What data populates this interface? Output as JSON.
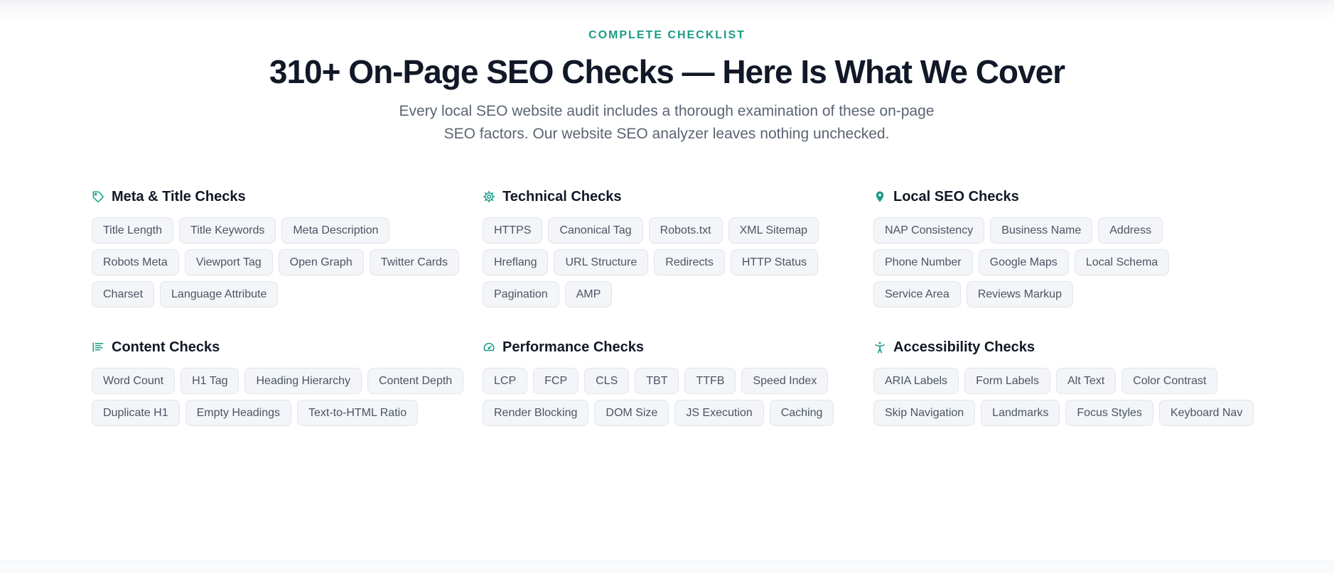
{
  "section": {
    "eyebrow": "COMPLETE CHECKLIST",
    "title": "310+ On-Page SEO Checks — Here Is What We Cover",
    "subtitle": "Every local SEO website audit includes a thorough examination of these on-page SEO factors. Our website SEO analyzer leaves nothing unchecked."
  },
  "colors": {
    "accent": "#1a9c86",
    "heading": "#111827",
    "tag_bg": "#f3f5f8",
    "tag_border": "#e1e5ea"
  },
  "groups": [
    {
      "icon": "tag-icon",
      "title": "Meta & Title Checks",
      "tags": [
        "Title Length",
        "Title Keywords",
        "Meta Description",
        "Robots Meta",
        "Viewport Tag",
        "Open Graph",
        "Twitter Cards",
        "Charset",
        "Language Attribute"
      ]
    },
    {
      "icon": "gear-icon",
      "title": "Technical Checks",
      "tags": [
        "HTTPS",
        "Canonical Tag",
        "Robots.txt",
        "XML Sitemap",
        "Hreflang",
        "URL Structure",
        "Redirects",
        "HTTP Status",
        "Pagination",
        "AMP"
      ]
    },
    {
      "icon": "map-pin-icon",
      "title": "Local SEO Checks",
      "tags": [
        "NAP Consistency",
        "Business Name",
        "Address",
        "Phone Number",
        "Google Maps",
        "Local Schema",
        "Service Area",
        "Reviews Markup"
      ]
    },
    {
      "icon": "text-align-icon",
      "title": "Content Checks",
      "tags": [
        "Word Count",
        "H1 Tag",
        "Heading Hierarchy",
        "Content Depth",
        "Duplicate H1",
        "Empty Headings",
        "Text-to-HTML Ratio"
      ]
    },
    {
      "icon": "gauge-icon",
      "title": "Performance Checks",
      "tags": [
        "LCP",
        "FCP",
        "CLS",
        "TBT",
        "TTFB",
        "Speed Index",
        "Render Blocking",
        "DOM Size",
        "JS Execution",
        "Caching"
      ]
    },
    {
      "icon": "accessibility-icon",
      "title": "Accessibility Checks",
      "tags": [
        "ARIA Labels",
        "Form Labels",
        "Alt Text",
        "Color Contrast",
        "Skip Navigation",
        "Landmarks",
        "Focus Styles",
        "Keyboard Nav"
      ]
    }
  ]
}
